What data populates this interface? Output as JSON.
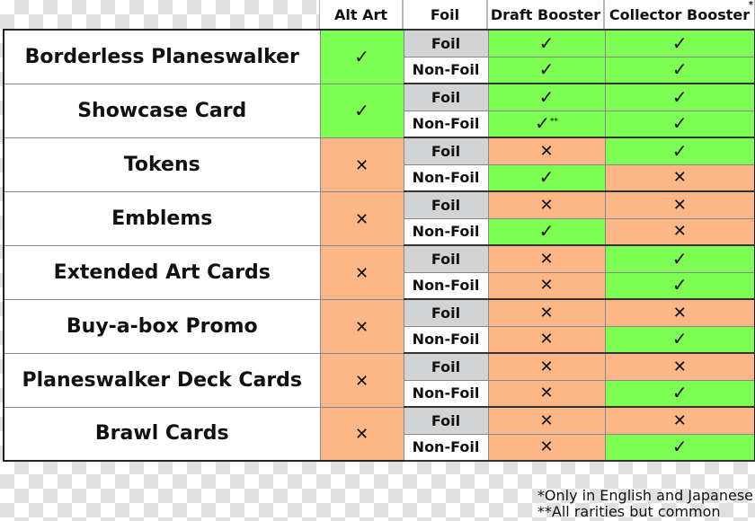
{
  "columns": {
    "alt_art": "Alt Art",
    "foil": "Foil",
    "draft_booster": "Draft Booster",
    "collector_booster": "Collector Booster",
    "collector_booster_mark": "*"
  },
  "symbols": {
    "yes": "✓",
    "no": "✕",
    "yes_icon": "check-icon",
    "no_icon": "cross-icon"
  },
  "colors": {
    "yes": "#7efe54",
    "no": "#fdb688",
    "foil_row": "#d2d3d5"
  },
  "rows": [
    {
      "name": "Borderless Planeswalker",
      "alt_art": "✓",
      "variants": [
        {
          "label": "Foil",
          "draft": "✓",
          "draft_note": "",
          "collector": "✓"
        },
        {
          "label": "Non-Foil",
          "draft": "✓",
          "draft_note": "",
          "collector": "✓"
        }
      ]
    },
    {
      "name": "Showcase Card",
      "alt_art": "✓",
      "variants": [
        {
          "label": "Foil",
          "draft": "✓",
          "draft_note": "",
          "collector": "✓"
        },
        {
          "label": "Non-Foil",
          "draft": "✓",
          "draft_note": "**",
          "collector": "✓"
        }
      ]
    },
    {
      "name": "Tokens",
      "alt_art": "✕",
      "variants": [
        {
          "label": "Foil",
          "draft": "✕",
          "draft_note": "",
          "collector": "✓"
        },
        {
          "label": "Non-Foil",
          "draft": "✓",
          "draft_note": "",
          "collector": "✕"
        }
      ]
    },
    {
      "name": "Emblems",
      "alt_art": "✕",
      "variants": [
        {
          "label": "Foil",
          "draft": "✕",
          "draft_note": "",
          "collector": "✕"
        },
        {
          "label": "Non-Foil",
          "draft": "✓",
          "draft_note": "",
          "collector": "✕"
        }
      ]
    },
    {
      "name": "Extended Art Cards",
      "alt_art": "✕",
      "variants": [
        {
          "label": "Foil",
          "draft": "✕",
          "draft_note": "",
          "collector": "✓"
        },
        {
          "label": "Non-Foil",
          "draft": "✕",
          "draft_note": "",
          "collector": "✓"
        }
      ]
    },
    {
      "name": "Buy-a-box Promo",
      "alt_art": "✕",
      "variants": [
        {
          "label": "Foil",
          "draft": "✕",
          "draft_note": "",
          "collector": "✕"
        },
        {
          "label": "Non-Foil",
          "draft": "✕",
          "draft_note": "",
          "collector": "✓"
        }
      ]
    },
    {
      "name": "Planeswalker Deck Cards",
      "alt_art": "✕",
      "variants": [
        {
          "label": "Foil",
          "draft": "✕",
          "draft_note": "",
          "collector": "✕"
        },
        {
          "label": "Non-Foil",
          "draft": "✕",
          "draft_note": "",
          "collector": "✓"
        }
      ]
    },
    {
      "name": "Brawl Cards",
      "alt_art": "✕",
      "variants": [
        {
          "label": "Foil",
          "draft": "✕",
          "draft_note": "",
          "collector": "✕"
        },
        {
          "label": "Non-Foil",
          "draft": "✕",
          "draft_note": "",
          "collector": "✓"
        }
      ]
    }
  ],
  "footnotes": [
    "*Only in English and Japanese",
    "**All rarities but common"
  ]
}
